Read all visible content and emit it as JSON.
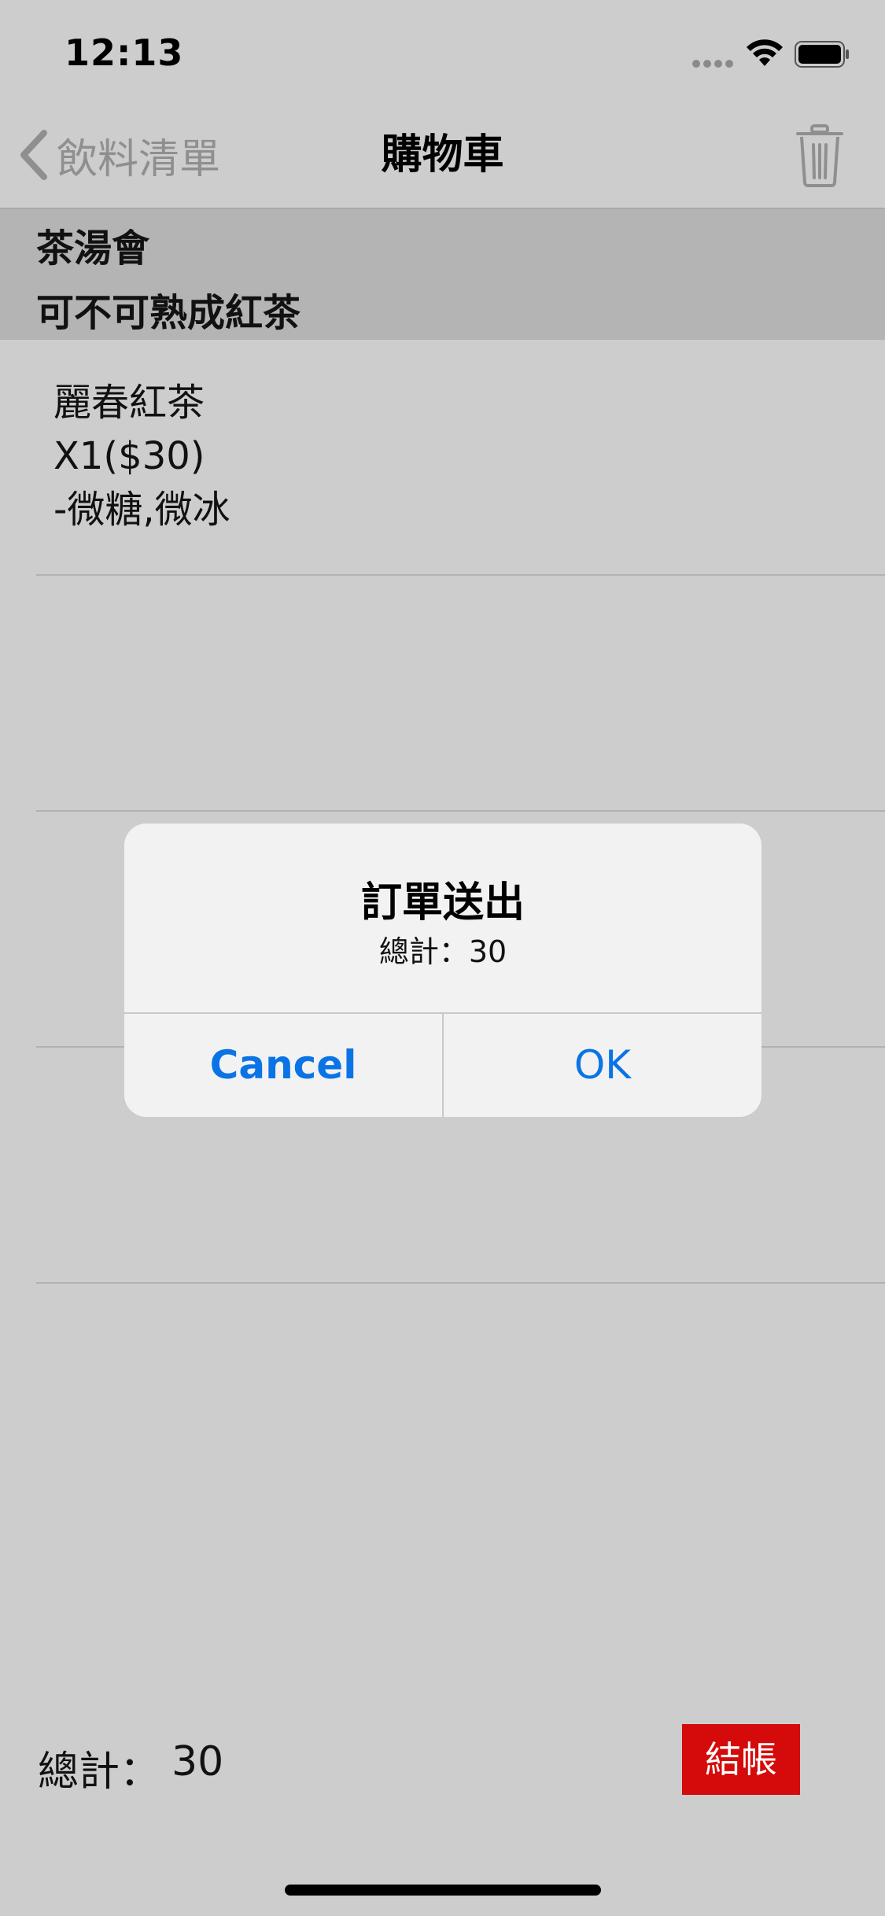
{
  "status_bar": {
    "time": "12:13"
  },
  "nav": {
    "back_label": "飲料清單",
    "title": "購物車"
  },
  "section": {
    "shop": "茶湯會",
    "brand": "可不可熟成紅茶"
  },
  "cart_items": [
    {
      "name": "麗春紅茶",
      "qty_price": "X1($30)",
      "options": "-微糖,微冰"
    }
  ],
  "footer": {
    "total_label": "總計：",
    "total_value": "30",
    "checkout_label": "結帳"
  },
  "alert": {
    "title": "訂單送出",
    "message": "總計：30",
    "cancel_label": "Cancel",
    "ok_label": "OK"
  },
  "colors": {
    "accent": "#0a74e6",
    "checkout_bg": "#d50b0b",
    "background": "#cdcdcd",
    "section_bg": "#b4b4b4"
  },
  "icons": {
    "back": "chevron-left-icon",
    "trash": "trash-icon"
  }
}
